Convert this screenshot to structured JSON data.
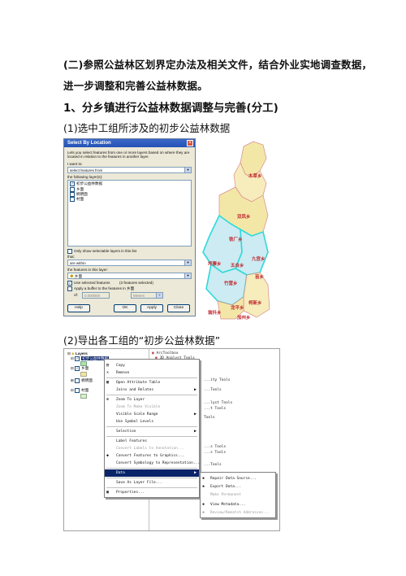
{
  "doc": {
    "para1_line1": "(二)参照公益林区划界定办法及相关文件，结合外业实地调查数据，",
    "para1_line2": "进一步调整和完善公益林数据。",
    "heading": "1、分乡镇进行公益林数据调整与完善(分工)",
    "sub1": "(1)选中工组所涉及的初步公益林数据",
    "sub2": "(2)导出各工组的“初步公益林数据”"
  },
  "dialog": {
    "title": "Select By Location",
    "desc1": "Lets you select features from one or more layers based on where they are",
    "desc2": "located in relation to the features in another layer.",
    "i_want_to": "I want to:",
    "method": "select features from",
    "following_layers": "the following layer(s):",
    "layers": [
      "初步公益林数据",
      "乡面",
      "稠明面",
      "村面"
    ],
    "only_selectable": "Only show selectable layers in this list",
    "that": "that:",
    "relation": "are within",
    "in_layer": "the features in this layer:",
    "layer_value": "乡面",
    "use_selected": "Use selected features",
    "selected_count": "(3 features selected)",
    "apply_buffer": "Apply a buffer to the features in 乡面",
    "of": "of:",
    "buffer_value": "0.000000",
    "buffer_unit": "Meters",
    "buttons": {
      "help": "Help",
      "ok": "OK",
      "apply": "Apply",
      "close": "Close"
    }
  },
  "map": {
    "labels": [
      "木草乡",
      "双凤乡",
      "铁厂乡",
      "坪寨乡",
      "五合乡",
      "九宫乡",
      "竹营乡",
      "苗乡",
      "翁抖乡",
      "龙平乡",
      "柯新乡",
      "加州乡"
    ]
  },
  "arcmap": {
    "toc": {
      "root": "Layers",
      "layers": [
        "初步公益林数据",
        "乡面",
        "稠明面",
        "村面"
      ]
    },
    "menu": [
      {
        "label": "Copy",
        "icon": "copy-icon",
        "glyph": "▤",
        "disabled": false
      },
      {
        "label": "Remove",
        "icon": "remove-icon",
        "glyph": "✕",
        "disabled": false
      },
      {
        "label": "Open Attribute Table",
        "icon": "table-icon",
        "glyph": "▦",
        "disabled": false
      },
      {
        "label": "Joins and Relates",
        "icon": "",
        "glyph": "",
        "disabled": false,
        "submenu": true
      },
      {
        "label": "Zoom To Layer",
        "icon": "zoom-icon",
        "glyph": "⊕",
        "disabled": false
      },
      {
        "label": "Zoom To Make Visible",
        "icon": "",
        "glyph": "",
        "disabled": true
      },
      {
        "label": "Visible Scale Range",
        "icon": "",
        "glyph": "",
        "disabled": false,
        "submenu": true
      },
      {
        "label": "Use Symbol Levels",
        "icon": "",
        "glyph": "",
        "disabled": false
      },
      {
        "label": "Selection",
        "icon": "",
        "glyph": "",
        "disabled": false,
        "submenu": true
      },
      {
        "label": "Label Features",
        "icon": "",
        "glyph": "",
        "disabled": false
      },
      {
        "label": "Convert Labels to Annotation...",
        "icon": "",
        "glyph": "",
        "disabled": true
      },
      {
        "label": "Convert Features to Graphics...",
        "icon": "graphics-icon",
        "glyph": "◆",
        "disabled": false
      },
      {
        "label": "Convert Symbology to Representation...",
        "icon": "",
        "glyph": "",
        "disabled": false
      },
      {
        "label": "Data",
        "icon": "",
        "glyph": "",
        "disabled": false,
        "submenu": true,
        "selected": true
      },
      {
        "label": "Save As Layer File...",
        "icon": "",
        "glyph": "",
        "disabled": false
      },
      {
        "label": "Properties...",
        "icon": "properties-icon",
        "glyph": "▣",
        "disabled": false
      }
    ],
    "submenu": [
      {
        "label": "Repair Data Source...",
        "disabled": false
      },
      {
        "label": "Export Data...",
        "disabled": false
      },
      {
        "label": "Make Permanent",
        "disabled": true
      },
      {
        "label": "View Metadata...",
        "disabled": false
      },
      {
        "label": "Review/Rematch Addresses...",
        "disabled": true
      }
    ],
    "toolbox": [
      "ArcToolbox",
      "3D Analyst Tools",
      "...ity Tools",
      "...Tools",
      "...lyst Tools",
      "...t Tools",
      "Tools",
      "...s Tools",
      "...s Tools",
      "...Tools"
    ]
  }
}
